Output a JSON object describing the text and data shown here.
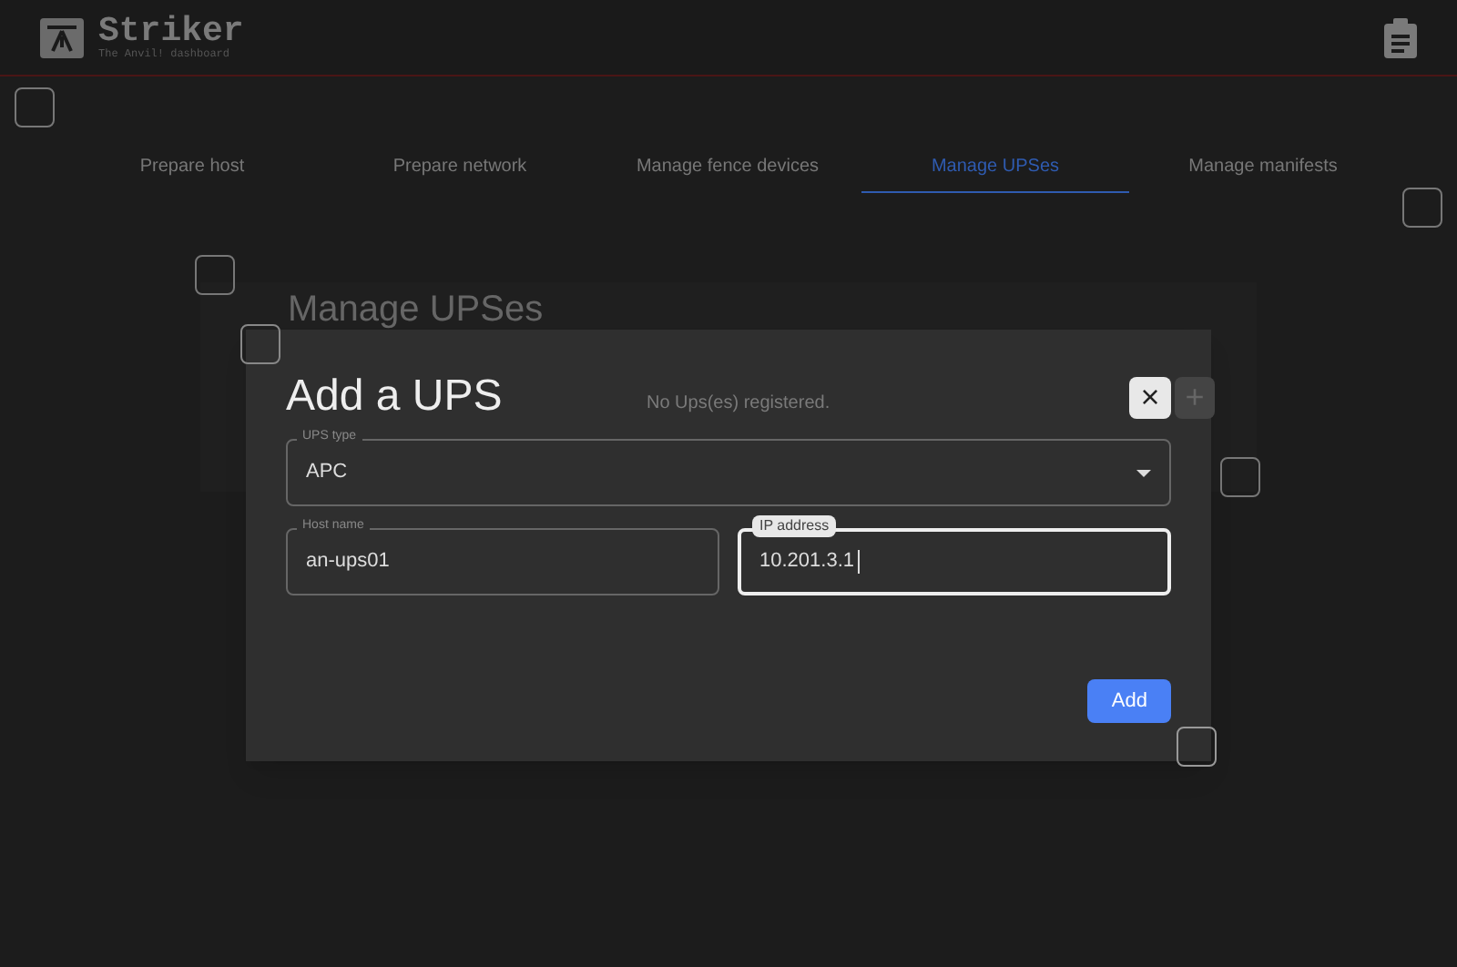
{
  "header": {
    "logo_title": "Striker",
    "logo_subtitle": "The Anvil! dashboard"
  },
  "tabs": [
    {
      "label": "Prepare host",
      "selected": false
    },
    {
      "label": "Prepare network",
      "selected": false
    },
    {
      "label": "Manage fence devices",
      "selected": false
    },
    {
      "label": "Manage UPSes",
      "selected": true
    },
    {
      "label": "Manage manifests",
      "selected": false
    }
  ],
  "panel": {
    "title": "Manage UPSes",
    "empty_message": "No Ups(es) registered."
  },
  "dialog": {
    "title": "Add a UPS",
    "close_label": "×",
    "add_icon": "+",
    "fields": [
      {
        "kind": "select",
        "label": "UPS type",
        "value": "APC",
        "focused": false
      },
      {
        "kind": "text",
        "label": "Host name",
        "value": "an-ups01",
        "focused": false
      },
      {
        "kind": "text",
        "label": "IP address",
        "value": "10.201.3.1",
        "focused": true
      }
    ],
    "submit": "Add"
  }
}
